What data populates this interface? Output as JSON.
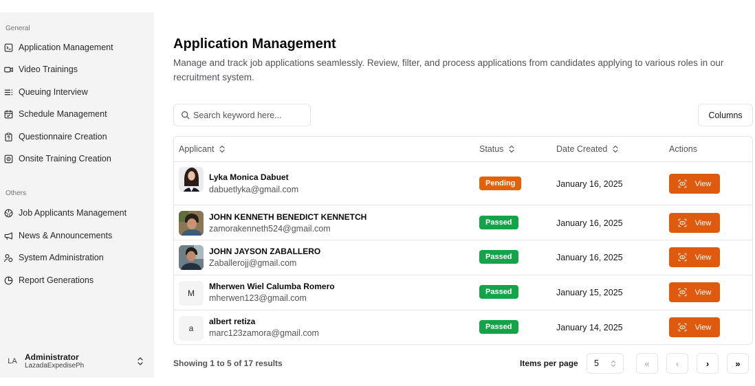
{
  "sidebar": {
    "general_label": "General",
    "general_items": [
      {
        "label": "Application Management",
        "icon": "terminal-square-icon"
      },
      {
        "label": "Video Trainings",
        "icon": "video-icon"
      },
      {
        "label": "Queuing Interview",
        "icon": "list-icon"
      },
      {
        "label": "Schedule Management",
        "icon": "calendar-icon"
      },
      {
        "label": "Questionnaire Creation",
        "icon": "clipboard-icon"
      },
      {
        "label": "Onsite Training Creation",
        "icon": "scan-icon"
      }
    ],
    "others_label": "Others",
    "others_items": [
      {
        "label": "Job Applicants Management",
        "icon": "aperture-icon"
      },
      {
        "label": "News & Announcements",
        "icon": "megaphone-icon"
      },
      {
        "label": "System Administration",
        "icon": "users-icon"
      },
      {
        "label": "Report Generations",
        "icon": "pie-chart-icon"
      }
    ],
    "user": {
      "initials": "LA",
      "name": "Administrator",
      "org": "LazadaExpedisePh"
    }
  },
  "main": {
    "title": "Application Management",
    "description": "Manage and track job applications seamlessly. Review, filter, and process applications from candidates applying to various roles in our recruitment system.",
    "search_placeholder": "Search keyword here...",
    "columns_label": "Columns"
  },
  "table": {
    "headers": {
      "applicant": "Applicant",
      "status": "Status",
      "date_created": "Date Created",
      "actions": "Actions"
    },
    "rows": [
      {
        "name": "Lyka Monica Dabuet",
        "email": "dabuetlyka@gmail.com",
        "status": "Pending",
        "date": "January 16, 2025",
        "action": "View",
        "avatar": "photo",
        "initial": ""
      },
      {
        "name": "JOHN KENNETH BENEDICT KENNETCH",
        "email": "zamorakenneth524@gmail.com",
        "status": "Passed",
        "date": "January 16, 2025",
        "action": "View",
        "avatar": "photo",
        "initial": ""
      },
      {
        "name": "JOHN JAYSON ZABALLERO",
        "email": "Zaballerojj@gmail.com",
        "status": "Passed",
        "date": "January 16, 2025",
        "action": "View",
        "avatar": "photo",
        "initial": ""
      },
      {
        "name": "Mherwen Wiel Calumba Romero",
        "email": "mherwen123@gmail.com",
        "status": "Passed",
        "date": "January 15, 2025",
        "action": "View",
        "avatar": "initial",
        "initial": "M"
      },
      {
        "name": "albert retiza",
        "email": "marc123zamora@gmail.com",
        "status": "Passed",
        "date": "January 14, 2025",
        "action": "View",
        "avatar": "initial",
        "initial": "a"
      }
    ]
  },
  "footer": {
    "showing": "Showing 1 to 5 of 17 results",
    "items_per_page_label": "Items per page",
    "items_per_page_value": "5",
    "pagination": {
      "first": "«",
      "prev": "‹",
      "next": "›",
      "last": "»"
    }
  },
  "colors": {
    "accent": "#dd5a0e",
    "pending": "#e0620d",
    "passed": "#15a34a",
    "sidebar_bg": "#f4f4f5",
    "border": "#e4e4e7"
  }
}
